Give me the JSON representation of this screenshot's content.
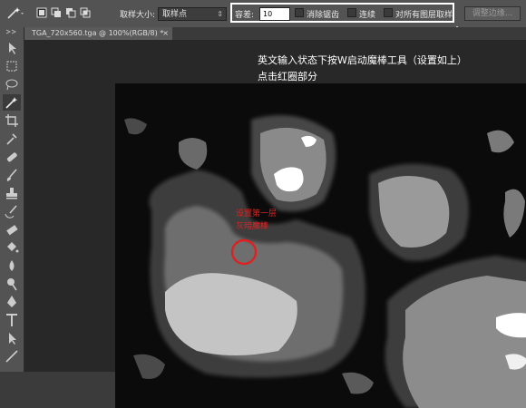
{
  "options": {
    "sample_size_label": "取样大小:",
    "sample_size_value": "取样点",
    "tolerance_label": "容差:",
    "tolerance_value": "10",
    "antialias_label": "消除锯齿",
    "contiguous_label": "连续",
    "sample_all_label": "对所有图层取样",
    "refine_edge_label": "调整边缘..."
  },
  "document_tab": {
    "title": "TGA_720x560.tga @ 100%(RGB/8) *",
    "close_glyph": "×"
  },
  "annotations": {
    "line1": "英文输入状态下按W启动魔棒工具（设置如上）",
    "line2": "点击红圈部分",
    "red_line1": "设置第一层",
    "red_line2": "灰暗魔棒"
  },
  "colors": {
    "highlight_circle": "#e02020",
    "highlight_box": "#ffffff"
  }
}
